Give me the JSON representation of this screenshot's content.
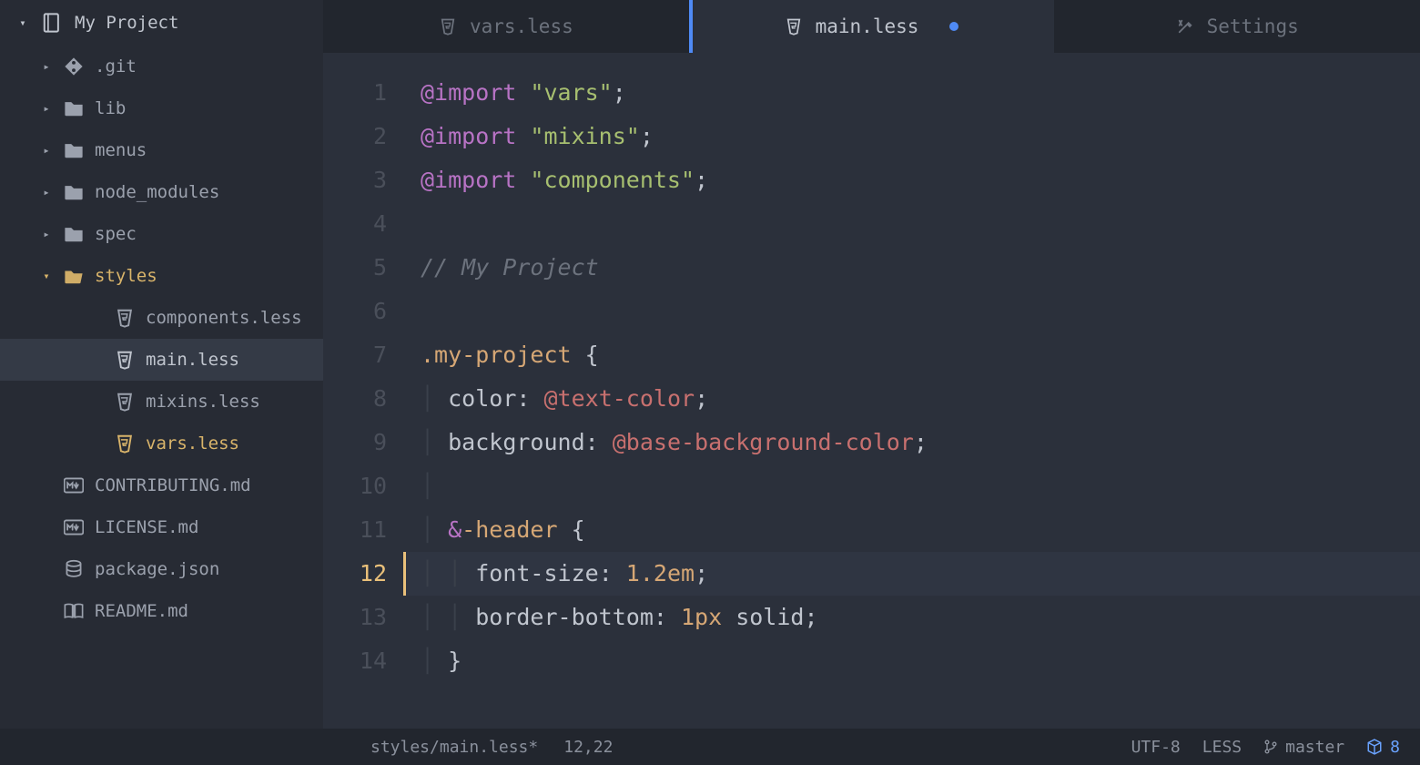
{
  "project": {
    "name": "My Project"
  },
  "tree": [
    {
      "label": ".git",
      "icon": "git",
      "type": "folder",
      "open": false,
      "depth": 1
    },
    {
      "label": "lib",
      "icon": "folder",
      "type": "folder",
      "open": false,
      "depth": 1
    },
    {
      "label": "menus",
      "icon": "folder",
      "type": "folder",
      "open": false,
      "depth": 1
    },
    {
      "label": "node_modules",
      "icon": "folder",
      "type": "folder",
      "open": false,
      "depth": 1
    },
    {
      "label": "spec",
      "icon": "folder",
      "type": "folder",
      "open": false,
      "depth": 1
    },
    {
      "label": "styles",
      "icon": "folder-open",
      "type": "folder",
      "open": true,
      "depth": 1,
      "highlight": "open-folder"
    },
    {
      "label": "components.less",
      "icon": "less",
      "type": "file",
      "depth": 2
    },
    {
      "label": "main.less",
      "icon": "less",
      "type": "file",
      "depth": 2,
      "selected": true
    },
    {
      "label": "mixins.less",
      "icon": "less",
      "type": "file",
      "depth": 2
    },
    {
      "label": "vars.less",
      "icon": "less",
      "type": "file",
      "depth": 2,
      "highlight": "open-file"
    },
    {
      "label": "CONTRIBUTING.md",
      "icon": "md",
      "type": "file",
      "depth": 1
    },
    {
      "label": "LICENSE.md",
      "icon": "md",
      "type": "file",
      "depth": 1
    },
    {
      "label": "package.json",
      "icon": "db",
      "type": "file",
      "depth": 1
    },
    {
      "label": "README.md",
      "icon": "book",
      "type": "file",
      "depth": 1
    }
  ],
  "tabs": [
    {
      "label": "vars.less",
      "icon": "less",
      "active": false,
      "dirty": false
    },
    {
      "label": "main.less",
      "icon": "less",
      "active": true,
      "dirty": true
    },
    {
      "label": "Settings",
      "icon": "settings",
      "active": false,
      "dirty": false
    }
  ],
  "code": {
    "lines": [
      {
        "n": 1,
        "tokens": [
          [
            "@import",
            "purple"
          ],
          [
            " ",
            "base"
          ],
          [
            "\"vars\"",
            "green"
          ],
          [
            ";",
            "base"
          ]
        ]
      },
      {
        "n": 2,
        "tokens": [
          [
            "@import",
            "purple"
          ],
          [
            " ",
            "base"
          ],
          [
            "\"mixins\"",
            "green"
          ],
          [
            ";",
            "base"
          ]
        ]
      },
      {
        "n": 3,
        "tokens": [
          [
            "@import",
            "purple"
          ],
          [
            " ",
            "base"
          ],
          [
            "\"components\"",
            "green"
          ],
          [
            ";",
            "base"
          ]
        ]
      },
      {
        "n": 4,
        "tokens": []
      },
      {
        "n": 5,
        "tokens": [
          [
            "// My Project",
            "comment"
          ]
        ]
      },
      {
        "n": 6,
        "tokens": []
      },
      {
        "n": 7,
        "tokens": [
          [
            ".my-project",
            "orange"
          ],
          [
            " {",
            "base"
          ]
        ]
      },
      {
        "n": 8,
        "indent": 1,
        "tokens": [
          [
            "color",
            "base"
          ],
          [
            ": ",
            "base"
          ],
          [
            "@text-color",
            "red"
          ],
          [
            ";",
            "base"
          ]
        ]
      },
      {
        "n": 9,
        "indent": 1,
        "tokens": [
          [
            "background",
            "base"
          ],
          [
            ": ",
            "base"
          ],
          [
            "@base-background-color",
            "red"
          ],
          [
            ";",
            "base"
          ]
        ]
      },
      {
        "n": 10,
        "indent": 1,
        "tokens": []
      },
      {
        "n": 11,
        "indent": 1,
        "tokens": [
          [
            "&",
            "purple"
          ],
          [
            "-header",
            "orange"
          ],
          [
            " {",
            "base"
          ]
        ]
      },
      {
        "n": 12,
        "indent": 2,
        "active": true,
        "tokens": [
          [
            "font-size",
            "base"
          ],
          [
            ": ",
            "base"
          ],
          [
            "1.2em",
            "orange"
          ],
          [
            ";",
            "base"
          ]
        ]
      },
      {
        "n": 13,
        "indent": 2,
        "tokens": [
          [
            "border-bottom",
            "base"
          ],
          [
            ": ",
            "base"
          ],
          [
            "1px",
            "orange"
          ],
          [
            " solid;",
            "base"
          ]
        ]
      },
      {
        "n": 14,
        "indent": 1,
        "tokens": [
          [
            "}",
            "base"
          ]
        ]
      }
    ]
  },
  "status": {
    "path": "styles/main.less*",
    "cursor": "12,22",
    "encoding": "UTF-8",
    "language": "LESS",
    "branch": "master",
    "package_count": "8"
  }
}
